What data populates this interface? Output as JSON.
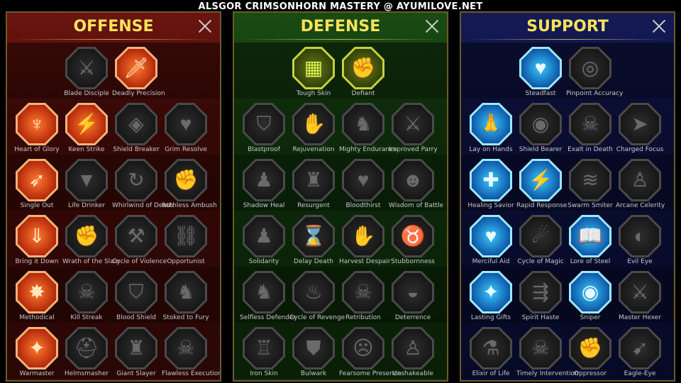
{
  "page_title": "ALSGOR CRIMSONHORN MASTERY @ AYUMILOVE.NET",
  "trees": [
    {
      "id": "offense",
      "title": "OFFENSE",
      "rows": [
        [
          {
            "label": "Blade Disciple",
            "active": false,
            "icon": "crossed-swords-icon",
            "g": "⚔"
          },
          {
            "label": "Deadly Precision",
            "active": true,
            "icon": "blade-icon",
            "g": "🗡"
          }
        ],
        [
          {
            "label": "Heart of Glory",
            "active": true,
            "icon": "demon-woman-icon",
            "g": "♆"
          },
          {
            "label": "Keen Strike",
            "active": true,
            "icon": "strike-icon",
            "g": "⚡"
          },
          {
            "label": "Shield Breaker",
            "active": false,
            "icon": "broken-shield-icon",
            "g": "◈"
          },
          {
            "label": "Grim Resolve",
            "active": false,
            "icon": "grim-heart-icon",
            "g": "♥"
          }
        ],
        [
          {
            "label": "Single Out",
            "active": true,
            "icon": "arrows-target-icon",
            "g": "➶"
          },
          {
            "label": "Life Drinker",
            "active": false,
            "icon": "fangs-icon",
            "g": "▼"
          },
          {
            "label": "Whirlwind of Death",
            "active": false,
            "icon": "whirlwind-icon",
            "g": "↻"
          },
          {
            "label": "Ruthless Ambush",
            "active": false,
            "icon": "dagger-hand-icon",
            "g": "✊"
          }
        ],
        [
          {
            "label": "Bring it Down",
            "active": true,
            "icon": "falling-sword-icon",
            "g": "⇓"
          },
          {
            "label": "Wrath of the Slain",
            "active": false,
            "icon": "fist-icon",
            "g": "✊"
          },
          {
            "label": "Cycle of Violence",
            "active": false,
            "icon": "axe-icon",
            "g": "⚒"
          },
          {
            "label": "Opportunist",
            "active": false,
            "icon": "chain-icon",
            "g": "⛓"
          }
        ],
        [
          {
            "label": "Methodical",
            "active": true,
            "icon": "explosion-icon",
            "g": "✸"
          },
          {
            "label": "Kill Streak",
            "active": false,
            "icon": "skull-icon",
            "g": "☠"
          },
          {
            "label": "Blood Shield",
            "active": false,
            "icon": "round-shield-icon",
            "g": "⛉"
          },
          {
            "label": "Stoked to Fury",
            "active": false,
            "icon": "warrior-icon",
            "g": "♞"
          }
        ],
        [
          {
            "label": "Warmaster",
            "active": true,
            "icon": "sword-sparks-icon",
            "g": "✦"
          },
          {
            "label": "Helmsmasher",
            "active": false,
            "icon": "helmet-icon",
            "g": "⛑"
          },
          {
            "label": "Giant Slayer",
            "active": false,
            "icon": "giant-icon",
            "g": "♜"
          },
          {
            "label": "Flawless Execution",
            "active": false,
            "icon": "execution-skull-icon",
            "g": "☠"
          }
        ]
      ]
    },
    {
      "id": "defense",
      "title": "DEFENSE",
      "rows": [
        [
          {
            "label": "Tough Skin",
            "active": true,
            "icon": "scales-icon",
            "g": "▦"
          },
          {
            "label": "Defiant",
            "active": true,
            "icon": "raised-fist-icon",
            "g": "✊"
          }
        ],
        [
          {
            "label": "Blastproof",
            "active": false,
            "icon": "shield-chevron-icon",
            "g": "⛉"
          },
          {
            "label": "Rejuvenation",
            "active": false,
            "icon": "hand-heart-icon",
            "g": "✋"
          },
          {
            "label": "Mighty Endurance",
            "active": false,
            "icon": "muscle-icon",
            "g": "♞"
          },
          {
            "label": "Improved Parry",
            "active": false,
            "icon": "parry-blades-icon",
            "g": "⚔"
          }
        ],
        [
          {
            "label": "Shadow Heal",
            "active": false,
            "icon": "shadow-figure-icon",
            "g": "♟"
          },
          {
            "label": "Resurgent",
            "active": false,
            "icon": "knight-shield-icon",
            "g": "♜"
          },
          {
            "label": "Bloodthirst",
            "active": false,
            "icon": "heart-skull-icon",
            "g": "♥"
          },
          {
            "label": "Wisdom of Battle",
            "active": false,
            "icon": "head-icon",
            "g": "☻"
          }
        ],
        [
          {
            "label": "Solidarity",
            "active": false,
            "icon": "crowd-icon",
            "g": "♟"
          },
          {
            "label": "Delay Death",
            "active": false,
            "icon": "hourglass-icon",
            "g": "⌛"
          },
          {
            "label": "Harvest Despair",
            "active": false,
            "icon": "open-hand-icon",
            "g": "✋"
          },
          {
            "label": "Stubbornness",
            "active": false,
            "icon": "bull-icon",
            "g": "♉"
          }
        ],
        [
          {
            "label": "Selfless Defender",
            "active": false,
            "icon": "defender-icon",
            "g": "♞"
          },
          {
            "label": "Cycle of Revenge",
            "active": false,
            "icon": "flames-icon",
            "g": "♨"
          },
          {
            "label": "Retribution",
            "active": false,
            "icon": "burning-skull-icon",
            "g": "☠"
          },
          {
            "label": "Deterrence",
            "active": false,
            "icon": "deflect-icon",
            "g": "◒"
          }
        ],
        [
          {
            "label": "Iron Skin",
            "active": false,
            "icon": "armored-man-icon",
            "g": "♖"
          },
          {
            "label": "Bulwark",
            "active": false,
            "icon": "bulwark-shield-icon",
            "g": "⛊"
          },
          {
            "label": "Fearsome Presence",
            "active": false,
            "icon": "fearsome-face-icon",
            "g": "☹"
          },
          {
            "label": "Unshakeable",
            "active": false,
            "icon": "strongman-icon",
            "g": "♙"
          }
        ]
      ]
    },
    {
      "id": "support",
      "title": "SUPPORT",
      "rows": [
        [
          {
            "label": "Steadfast",
            "active": true,
            "icon": "heart-hands-icon",
            "g": "♥"
          },
          {
            "label": "Pinpoint Accuracy",
            "active": false,
            "icon": "spiral-icon",
            "g": "◎"
          }
        ],
        [
          {
            "label": "Lay on Hands",
            "active": true,
            "icon": "praying-hands-icon",
            "g": "🙏"
          },
          {
            "label": "Shield Bearer",
            "active": false,
            "icon": "aura-shield-icon",
            "g": "◉"
          },
          {
            "label": "Exalt in Death",
            "active": false,
            "icon": "skull-smoke-icon",
            "g": "☠"
          },
          {
            "label": "Charged Focus",
            "active": false,
            "icon": "charging-fist-icon",
            "g": "➤"
          }
        ],
        [
          {
            "label": "Healing Savior",
            "active": true,
            "icon": "healing-figure-icon",
            "g": "✚"
          },
          {
            "label": "Rapid Response",
            "active": true,
            "icon": "lightning-icon",
            "g": "⚡"
          },
          {
            "label": "Swarm Smiter",
            "active": false,
            "icon": "swarm-icon",
            "g": "≋"
          },
          {
            "label": "Arcane Celerity",
            "active": false,
            "icon": "running-figures-icon",
            "g": "♙"
          }
        ],
        [
          {
            "label": "Merciful Aid",
            "active": true,
            "icon": "chained-heart-icon",
            "g": "♥"
          },
          {
            "label": "Cycle of Magic",
            "active": false,
            "icon": "fireball-icon",
            "g": "☄"
          },
          {
            "label": "Lore of Steel",
            "active": true,
            "icon": "open-book-icon",
            "g": "📖"
          },
          {
            "label": "Evil Eye",
            "active": false,
            "icon": "evil-eye-icon",
            "g": "◐"
          }
        ],
        [
          {
            "label": "Lasting Gifts",
            "active": true,
            "icon": "compass-star-icon",
            "g": "✦"
          },
          {
            "label": "Spirit Haste",
            "active": false,
            "icon": "running-boot-icon",
            "g": "⇶"
          },
          {
            "label": "Sniper",
            "active": true,
            "icon": "eye-icon",
            "g": "◉"
          },
          {
            "label": "Master Hexer",
            "active": false,
            "icon": "hex-figure-icon",
            "g": "⚔"
          }
        ],
        [
          {
            "label": "Elixir of Life",
            "active": false,
            "icon": "potion-icon",
            "g": "⚗"
          },
          {
            "label": "Timely Intervention",
            "active": false,
            "icon": "hooded-skull-icon",
            "g": "☠"
          },
          {
            "label": "Oppressor",
            "active": false,
            "icon": "gauntlet-icon",
            "g": "✊"
          },
          {
            "label": "Eagle-Eye",
            "active": false,
            "icon": "eagle-icon",
            "g": "➹"
          }
        ]
      ]
    }
  ]
}
